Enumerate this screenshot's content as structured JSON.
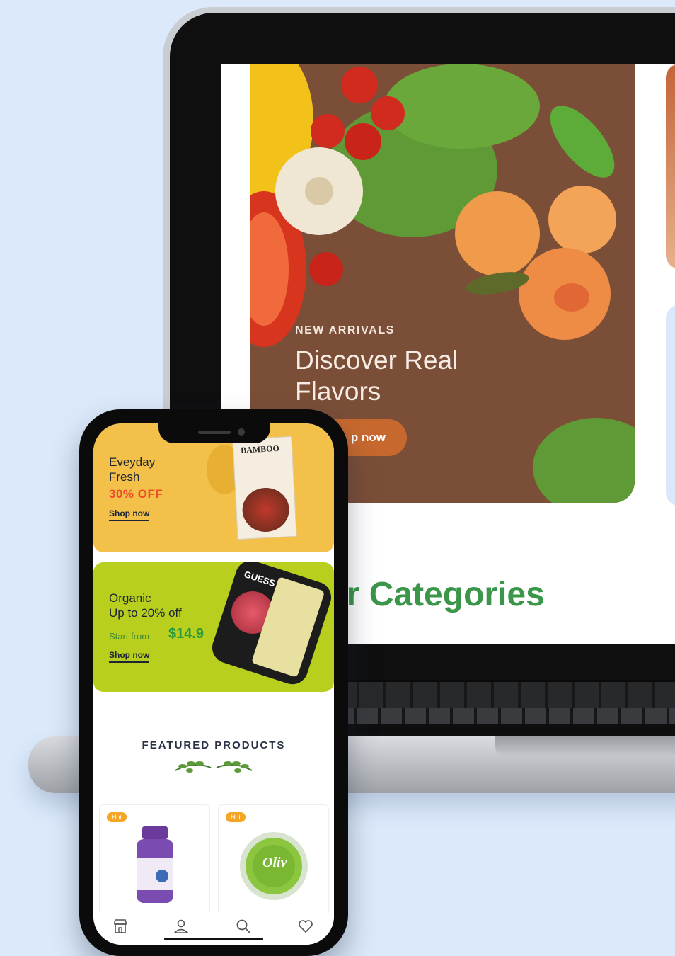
{
  "laptop": {
    "hero": {
      "eyebrow": "NEW ARRIVALS",
      "title": "Discover Real Flavors",
      "cta_label": "p now"
    },
    "categories_heading": "ar Categories"
  },
  "phone": {
    "banners": [
      {
        "title_line1": "Eveyday",
        "title_line2": "Fresh",
        "discount": "30% OFF",
        "cta_label": "Shop now",
        "product_brand": "BAMBOO",
        "bg_color": "#f3c14a"
      },
      {
        "title_line1": "Organic",
        "title_line2": "Up to 20% off",
        "start_label": "Start from",
        "price": "$14.9",
        "cta_label": "Shop now",
        "product_brand": "GUESS MEAT",
        "bg_color": "#b9cf1d"
      }
    ],
    "featured_heading": "FEATURED PRODUCTS",
    "products": [
      {
        "badge": "Hot",
        "icon": "supplement-bottle-icon"
      },
      {
        "badge": "Hot",
        "icon": "olive-jar-icon",
        "label": "Oliv"
      }
    ],
    "bottom_nav": [
      {
        "name": "store-icon"
      },
      {
        "name": "user-icon"
      },
      {
        "name": "search-icon"
      },
      {
        "name": "heart-icon"
      }
    ]
  },
  "colors": {
    "page_bg": "#dbe9fb",
    "accent_green": "#3a9649",
    "cta_orange": "#c7692f",
    "discount_red": "#ef4a2a",
    "hot_badge": "#f5a623"
  }
}
